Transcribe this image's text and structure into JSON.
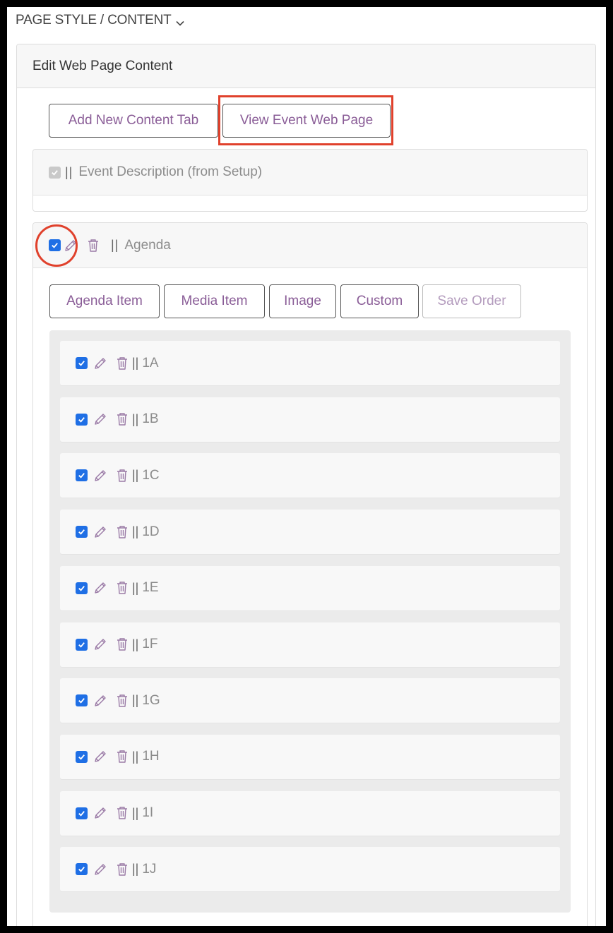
{
  "header": {
    "title": "PAGE STYLE / CONTENT"
  },
  "panel": {
    "title": "Edit Web Page Content"
  },
  "toolbar": {
    "add_tab_label": "Add New Content Tab",
    "view_page_label": "View Event Web Page"
  },
  "tabs": [
    {
      "name": "Event Description (from Setup)",
      "checked": true,
      "disabled": true
    },
    {
      "name": "Agenda",
      "checked": true,
      "disabled": false
    }
  ],
  "drag_handle": "||",
  "agenda_toolbar": {
    "agenda_item": "Agenda Item",
    "media_item": "Media Item",
    "image": "Image",
    "custom": "Custom",
    "save_order": "Save Order"
  },
  "agenda_items": [
    {
      "label": "1A",
      "checked": true
    },
    {
      "label": "1B",
      "checked": true
    },
    {
      "label": "1C",
      "checked": true
    },
    {
      "label": "1D",
      "checked": true
    },
    {
      "label": "1E",
      "checked": true
    },
    {
      "label": "1F",
      "checked": true
    },
    {
      "label": "1G",
      "checked": true
    },
    {
      "label": "1H",
      "checked": true
    },
    {
      "label": "1I",
      "checked": true
    },
    {
      "label": "1J",
      "checked": true
    }
  ],
  "colors": {
    "accent": "#8a5d97",
    "checkbox": "#1f6fe5",
    "highlight": "#e0412c"
  },
  "icons": [
    "chevron-down-icon",
    "checkbox-icon",
    "pencil-icon",
    "trash-icon"
  ]
}
